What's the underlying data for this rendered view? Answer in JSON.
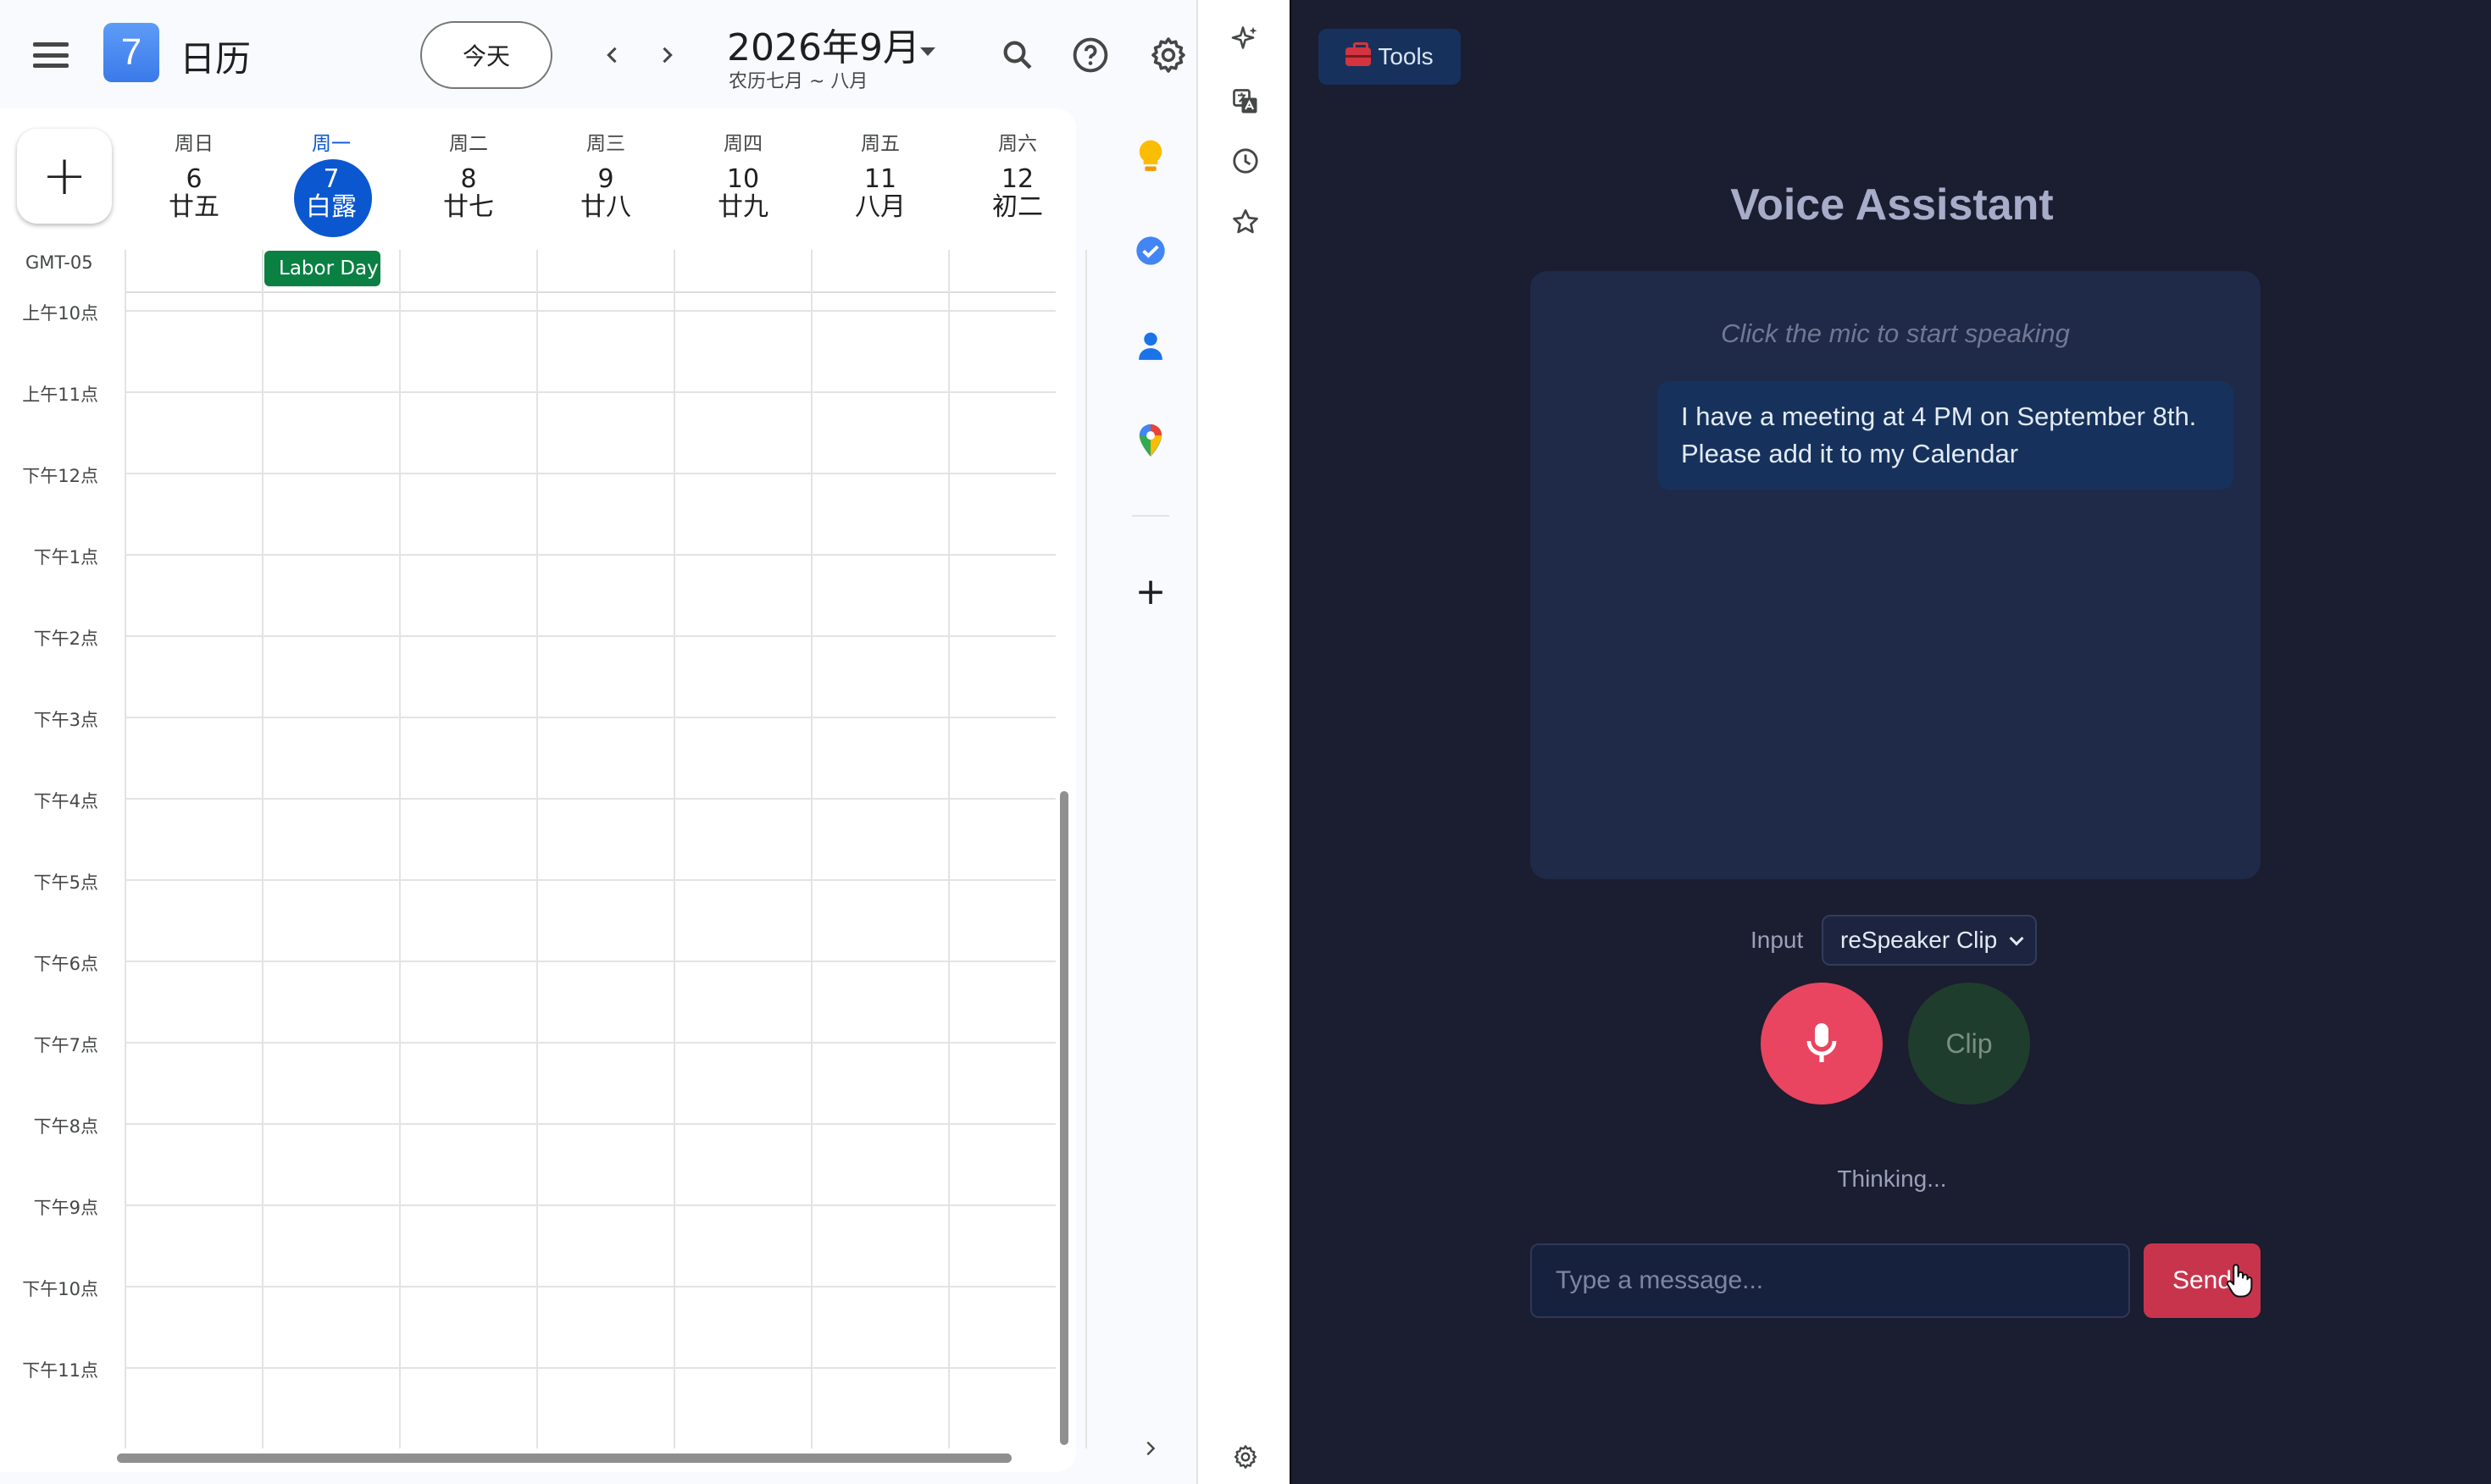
{
  "calendar": {
    "app_name": "日历",
    "logo_number": "7",
    "today_button": "今天",
    "prev_label": "‹",
    "next_label": "›",
    "month_title": "2026年9月",
    "lunar_subtitle": "农历七月 ~ 八月",
    "create_button": "+",
    "timezone": "GMT-05",
    "days": [
      {
        "dow": "周日",
        "date": "6",
        "lunar": "廿五",
        "today": false
      },
      {
        "dow": "周一",
        "date": "7",
        "lunar": "白露",
        "today": true
      },
      {
        "dow": "周二",
        "date": "8",
        "lunar": "廿七",
        "today": false
      },
      {
        "dow": "周三",
        "date": "9",
        "lunar": "廿八",
        "today": false
      },
      {
        "dow": "周四",
        "date": "10",
        "lunar": "廿九",
        "today": false
      },
      {
        "dow": "周五",
        "date": "11",
        "lunar": "八月",
        "today": false
      },
      {
        "dow": "周六",
        "date": "12",
        "lunar": "初二",
        "today": false
      }
    ],
    "all_day_event": "Labor Day",
    "hours": [
      "上午10点",
      "上午11点",
      "下午12点",
      "下午1点",
      "下午2点",
      "下午3点",
      "下午4点",
      "下午5点",
      "下午6点",
      "下午7点",
      "下午8点",
      "下午9点",
      "下午10点",
      "下午11点"
    ],
    "side_panel": {
      "icons": [
        "keep-icon",
        "tasks-icon",
        "contacts-icon",
        "maps-icon",
        "add-icon",
        "expand-chevron-icon"
      ],
      "add_label": "+",
      "expand_label": "›"
    },
    "header_icons": [
      "search-icon",
      "help-icon",
      "settings-icon"
    ],
    "colors": {
      "accent": "#0b57d0",
      "event": "#0b8043"
    }
  },
  "browser_strip": {
    "icons": [
      "sparkle-icon",
      "translate-icon",
      "history-icon",
      "star-icon",
      "settings-icon"
    ]
  },
  "assistant": {
    "tools_button": "Tools",
    "title": "Voice Assistant",
    "hint": "Click the mic to start speaking",
    "messages": [
      {
        "role": "user",
        "text": "I have a meeting at 4 PM on September 8th. Please add it to my Calendar"
      }
    ],
    "input_label": "Input",
    "input_device": "reSpeaker Clip",
    "clip_button": "Clip",
    "status": "Thinking...",
    "message_placeholder": "Type a message...",
    "send_button": "Send",
    "colors": {
      "background": "#1b1d30",
      "mic": "#e94560",
      "send": "#c9344d"
    }
  }
}
